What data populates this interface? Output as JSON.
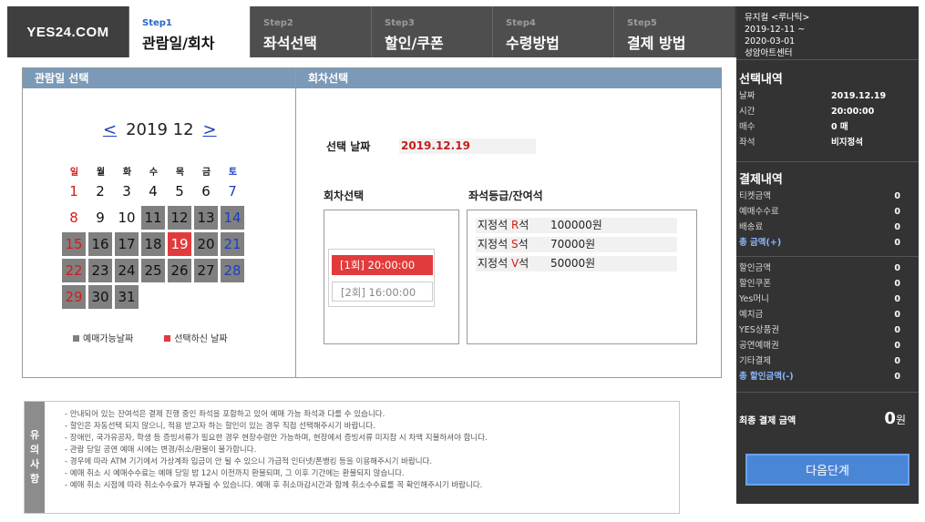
{
  "logo": {
    "text": "YES24.COM"
  },
  "steps": [
    {
      "num": "Step1",
      "label": "관람일/회차",
      "active": true
    },
    {
      "num": "Step2",
      "label": "좌석선택",
      "active": false
    },
    {
      "num": "Step3",
      "label": "할인/쿠폰",
      "active": false
    },
    {
      "num": "Step4",
      "label": "수령방법",
      "active": false
    },
    {
      "num": "Step5",
      "label": "결제 방법",
      "active": false
    }
  ],
  "performance": {
    "title": "뮤지컬 <루나틱>",
    "start": "2019-12-11 ~",
    "end": "2020-03-01",
    "venue": "성암아트센터"
  },
  "selection": {
    "title": "선택내역",
    "rows": [
      {
        "k": "날짜",
        "v": "2019.12.19"
      },
      {
        "k": "시간",
        "v": "20:00:00"
      },
      {
        "k": "매수",
        "v": "0 매"
      },
      {
        "k": "좌석",
        "v": "비지정석"
      }
    ]
  },
  "payment": {
    "title": "결제내역",
    "rows1": [
      {
        "k": "티켓금액",
        "v": "0"
      },
      {
        "k": "예매수수료",
        "v": "0"
      },
      {
        "k": "배송료",
        "v": "0"
      }
    ],
    "total1": {
      "k": "총 금액(+)",
      "v": "0"
    },
    "rows2": [
      {
        "k": "할인금액",
        "v": "0"
      },
      {
        "k": "할인쿠폰",
        "v": "0"
      },
      {
        "k": "Yes머니",
        "v": "0"
      },
      {
        "k": "예치금",
        "v": "0"
      },
      {
        "k": "YES상품권",
        "v": "0"
      },
      {
        "k": "공연예매권",
        "v": "0"
      },
      {
        "k": "기타결제",
        "v": "0"
      }
    ],
    "total2": {
      "k": "총 할인금액(-)",
      "v": "0"
    },
    "final_label": "최종 결제 금액",
    "final_value": "0",
    "final_unit": "원"
  },
  "next_button": "다음단계",
  "date_section": {
    "title": "관람일 선택",
    "prev": "<",
    "month_label": "2019 12",
    "next": ">",
    "weekdays": [
      "일",
      "월",
      "화",
      "수",
      "목",
      "금",
      "토"
    ],
    "days": [
      {
        "d": "1",
        "s": ""
      },
      {
        "d": "2",
        "s": ""
      },
      {
        "d": "3",
        "s": ""
      },
      {
        "d": "4",
        "s": ""
      },
      {
        "d": "5",
        "s": ""
      },
      {
        "d": "6",
        "s": ""
      },
      {
        "d": "7",
        "s": ""
      },
      {
        "d": "8",
        "s": ""
      },
      {
        "d": "9",
        "s": ""
      },
      {
        "d": "10",
        "s": ""
      },
      {
        "d": "11",
        "s": "avail"
      },
      {
        "d": "12",
        "s": "avail"
      },
      {
        "d": "13",
        "s": "avail"
      },
      {
        "d": "14",
        "s": "avail"
      },
      {
        "d": "15",
        "s": "avail"
      },
      {
        "d": "16",
        "s": "avail"
      },
      {
        "d": "17",
        "s": "avail"
      },
      {
        "d": "18",
        "s": "avail"
      },
      {
        "d": "19",
        "s": "selected"
      },
      {
        "d": "20",
        "s": "avail"
      },
      {
        "d": "21",
        "s": "avail"
      },
      {
        "d": "22",
        "s": "avail"
      },
      {
        "d": "23",
        "s": "avail"
      },
      {
        "d": "24",
        "s": "avail"
      },
      {
        "d": "25",
        "s": "avail"
      },
      {
        "d": "26",
        "s": "avail"
      },
      {
        "d": "27",
        "s": "avail"
      },
      {
        "d": "28",
        "s": "avail"
      },
      {
        "d": "29",
        "s": "avail"
      },
      {
        "d": "30",
        "s": "avail"
      },
      {
        "d": "31",
        "s": "avail"
      }
    ],
    "legend_available": "예매가능날짜",
    "legend_selected": "선택하신 날짜",
    "color_available": "#808080",
    "color_selected": "#e23b3b"
  },
  "session_section": {
    "title": "회차선택",
    "selected_date_label": "선택 날짜",
    "selected_date_value": "2019.12.19",
    "session_title": "회차선택",
    "sessions": [
      {
        "label": "[1회]  20:00:00",
        "selected": true
      },
      {
        "label": "[2회]  16:00:00",
        "selected": false
      }
    ],
    "grade_title": "좌석등급/잔여석",
    "grades": [
      {
        "pre": "지정석 ",
        "letter": "R",
        "post": "석",
        "price": "100000원"
      },
      {
        "pre": "지정석 ",
        "letter": "S",
        "post": "석",
        "price": "70000원"
      },
      {
        "pre": "지정석 ",
        "letter": "V",
        "post": "석",
        "price": "50000원"
      }
    ]
  },
  "notice": {
    "tag": [
      "유",
      "의",
      "사",
      "항"
    ],
    "items": [
      "- 안내되어 있는 잔여석은 결제 진행 중인 좌석을 포함하고 있어 예매 가능 좌석과 다를 수 있습니다.",
      "- 할인은 자동선택 되지 않으니, 적용 받고자 하는 할인이 있는 경우 직접 선택해주시기 바랍니다.",
      "- 장애인, 국가유공자, 학생 등 증빙서류가 필요한 경우 현장수령만 가능하며, 현장에서 증빙서류 미지참 시 차액 지불하셔야 합니다.",
      "- 관람 당일 공연 예매 시에는 변경/취소/환불이 불가합니다.",
      "- 경우에 따라 ATM 기기에서 가상계좌 입금이 안 될 수 있으니 가급적 인터넷/폰뱅킹 등을 이용해주시기 바랍니다.",
      "- 예매 취소 시 예매수수료는 예매 당일 밤 12시 이전까지 환불되며, 그 이후 기간에는 환불되지 않습니다.",
      "- 예매 취소 시점에 따라 취소수수료가 부과될 수 있습니다. 예매 후 취소마감시간과 함께 취소수수료를 꼭 확인해주시기 바랍니다."
    ]
  }
}
